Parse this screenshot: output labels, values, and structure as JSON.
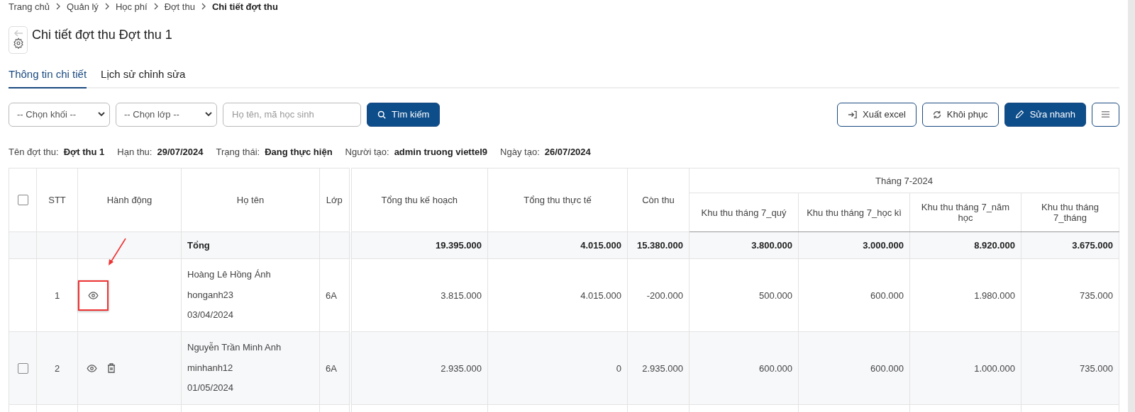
{
  "breadcrumb": [
    {
      "label": "Trang chủ",
      "current": false
    },
    {
      "label": "Quản lý",
      "current": false
    },
    {
      "label": "Học phí",
      "current": false
    },
    {
      "label": "Đợt thu",
      "current": false
    },
    {
      "label": "Chi tiết đợt thu",
      "current": true
    }
  ],
  "title": "Chi tiết đợt thu Đợt thu 1",
  "tabs": [
    {
      "label": "Thông tin chi tiết",
      "selected": true
    },
    {
      "label": "Lịch sử chỉnh sửa",
      "selected": false
    }
  ],
  "filters": {
    "grade_select": "-- Chọn khối --",
    "class_select": "-- Chọn lớp --",
    "search": {
      "placeholder": "Họ tên, mã học sinh"
    },
    "search_button": "Tìm kiếm"
  },
  "actions": [
    {
      "kind": "export",
      "label": "Xuất excel",
      "primary": false
    },
    {
      "kind": "restore",
      "label": "Khôi phục",
      "primary": false
    },
    {
      "kind": "quick_edit",
      "label": "Sửa nhanh",
      "primary": true
    },
    {
      "kind": "menu",
      "primary": false
    }
  ],
  "info": [
    {
      "label": "Tên đợt thu:",
      "value": "Đợt thu 1"
    },
    {
      "label": "Hạn thu:",
      "value": "29/07/2024"
    },
    {
      "label": "Trạng thái:",
      "value": "Đang thực hiện"
    },
    {
      "label": "Người tạo:",
      "value": "admin truong viettel9"
    },
    {
      "label": "Ngày tạo:",
      "value": "26/07/2024"
    }
  ],
  "table": {
    "select_all": {
      "checked": false
    },
    "columns": [
      "STT",
      "Hành động",
      "Họ tên",
      "Lớp",
      "Tổng thu kế hoạch",
      "Tổng thu thực tế",
      "Còn thu"
    ],
    "group": {
      "label": "Tháng 7-2024",
      "columns": [
        "Khu thu tháng 7_quý",
        "Khu thu tháng 7_học kì",
        "Khu thu tháng 7_năm học",
        "Khu thu tháng 7_tháng"
      ]
    },
    "total": {
      "label": "Tổng",
      "values": [
        "19.395.000",
        "4.015.000",
        "15.380.000",
        "3.800.000",
        "3.000.000",
        "8.920.000",
        "3.675.000"
      ]
    },
    "rows": [
      {
        "stt": "1",
        "actions": [
          {
            "kind": "view"
          }
        ],
        "highlighted": true,
        "name": "Hoàng Lê Hồng Ánh",
        "code": "honganh23",
        "date": "03/04/2024",
        "class": "6A",
        "values": [
          "3.815.000",
          "4.015.000",
          "-200.000",
          "500.000",
          "600.000",
          "1.980.000",
          "735.000"
        ]
      },
      {
        "stt": "2",
        "checkbox": {
          "checked": false
        },
        "actions": [
          {
            "kind": "view"
          },
          {
            "kind": "delete"
          }
        ],
        "highlighted": false,
        "name": "Nguyễn Trần Minh Anh",
        "code": "minhanh12",
        "date": "01/05/2024",
        "class": "6A",
        "values": [
          "2.935.000",
          "0",
          "2.935.000",
          "600.000",
          "600.000",
          "1.000.000",
          "735.000"
        ]
      }
    ]
  }
}
